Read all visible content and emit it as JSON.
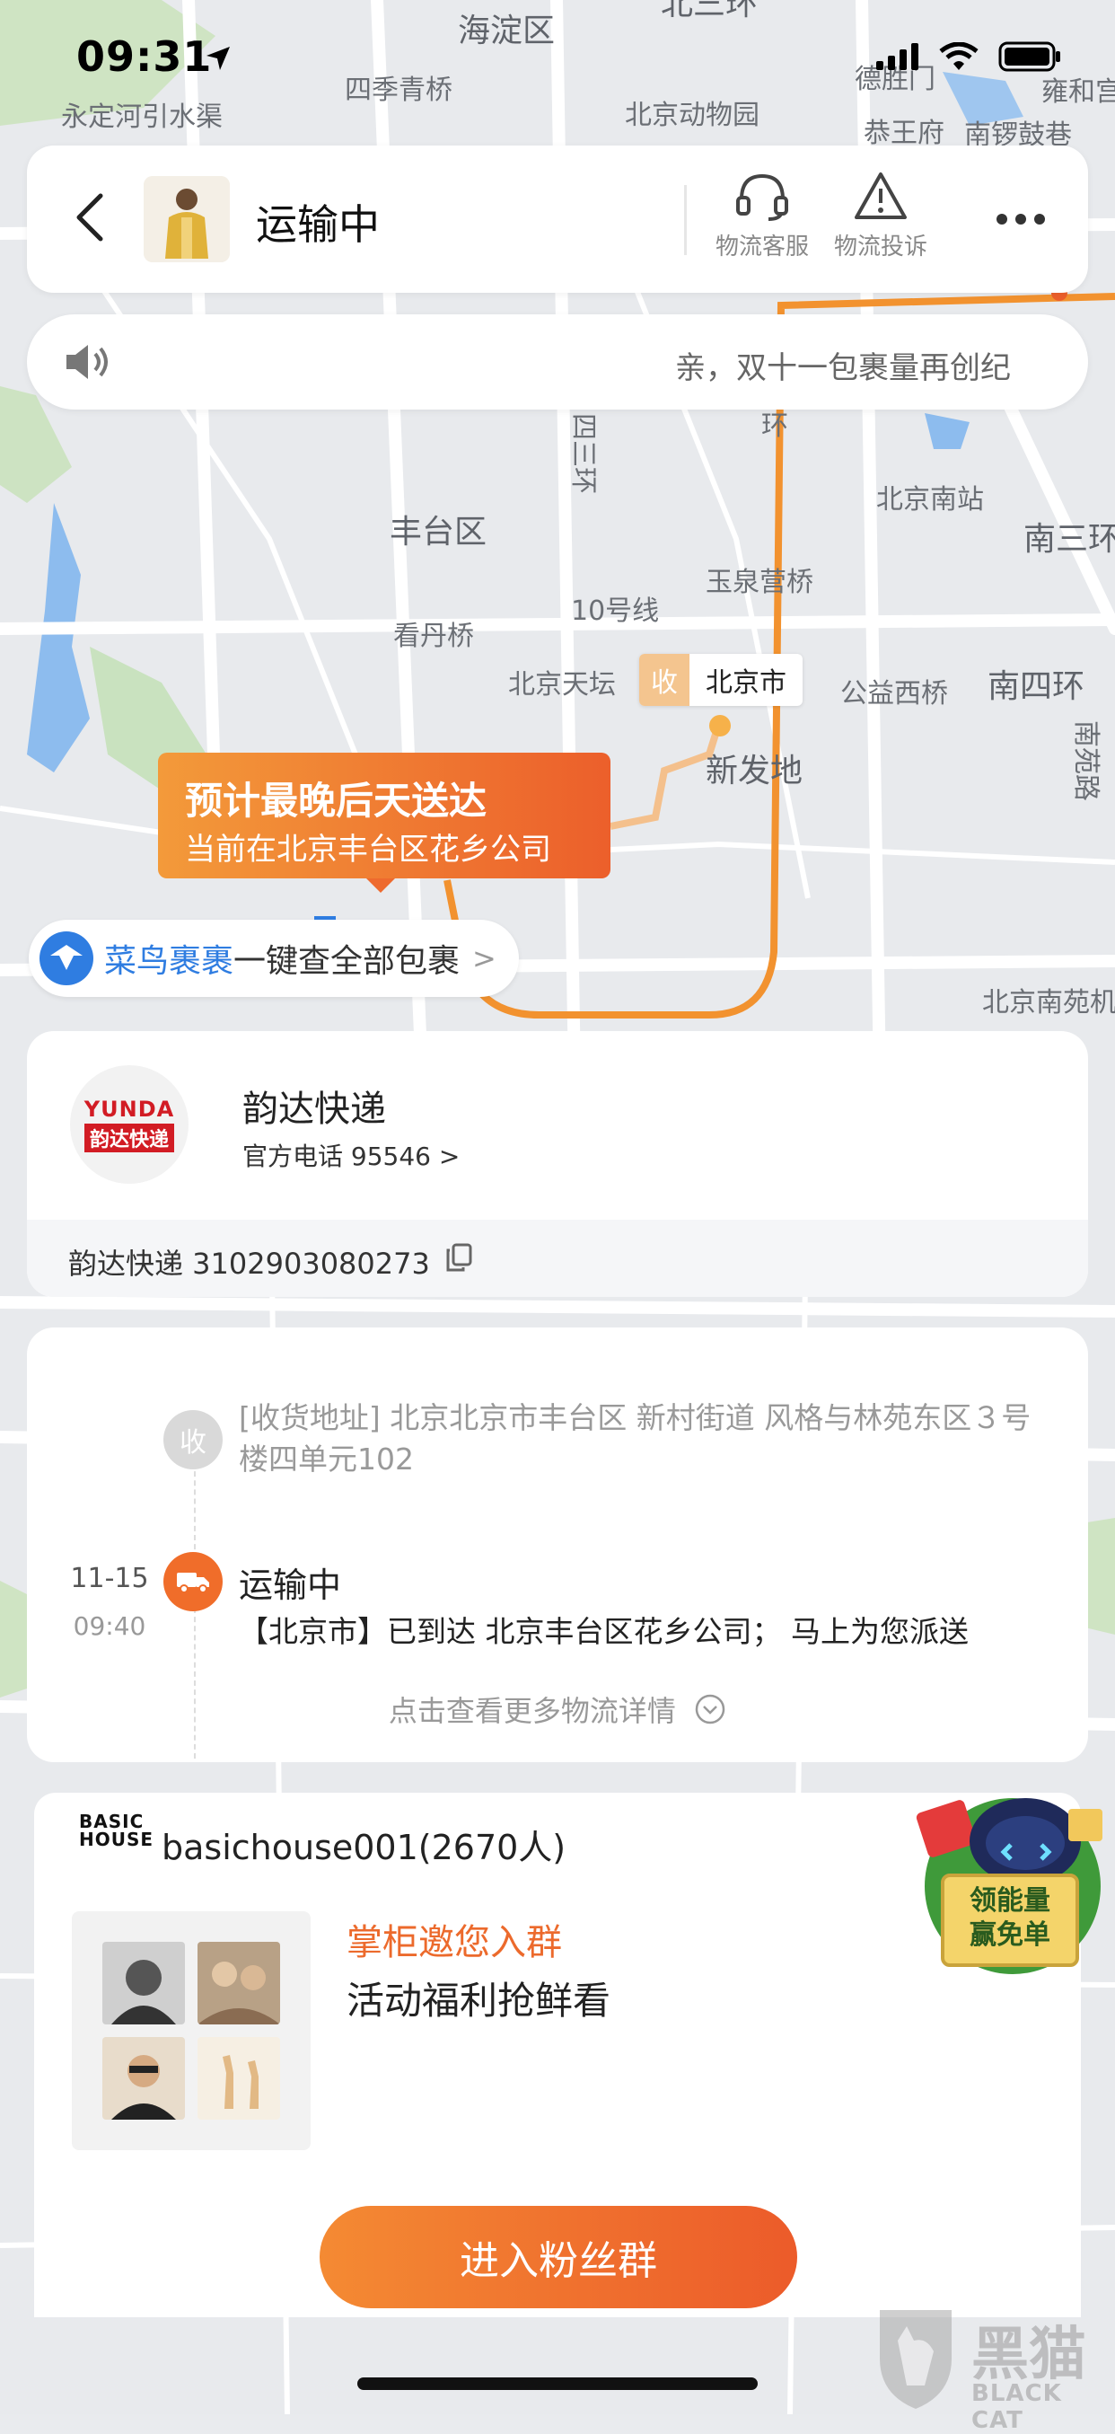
{
  "status_bar": {
    "time": "09:31"
  },
  "header": {
    "title": "运输中",
    "actions": [
      {
        "label": "物流客服",
        "icon": "headset-icon"
      },
      {
        "label": "物流投诉",
        "icon": "warning-icon"
      }
    ],
    "more_icon": "more-icon"
  },
  "notice": {
    "text": "亲，双十一包裹量再创纪"
  },
  "map": {
    "labels": [
      "海淀区",
      "四季青桥",
      "北京动物园",
      "德胜门",
      "雍和宫",
      "永定河引水渠",
      "恭王府",
      "南锣鼓巷",
      "北三环",
      "丰台区",
      "四三环",
      "北京南站",
      "南三环",
      "玉泉营桥",
      "10号线",
      "看丹桥",
      "北京天坛",
      "公益西桥",
      "南四环",
      "新发地",
      "南苑路",
      "北京南苑机",
      "环"
    ],
    "route_color": "#f2922f"
  },
  "eta": {
    "title": "预计最晚后天送达",
    "subtitle": "当前在北京丰台区花乡公司"
  },
  "destination": {
    "badge": "收",
    "label": "北京市"
  },
  "cainiao": {
    "brand": "菜鸟裹裹",
    "text": "一键查全部包裹",
    "arrow": ">"
  },
  "courier": {
    "logo_en": "YUNDA",
    "logo_cn": "韵达快递",
    "name": "韵达快递",
    "phone": "官方电话 95546 >",
    "tracking": "韵达快递 3102903080273"
  },
  "timeline": {
    "receiver_badge": "收",
    "receiver_address": "[收货地址] 北京北京市丰台区  新村街道   风格与林苑东区３号楼四单元102",
    "event": {
      "date": "11-15",
      "time": "09:40",
      "title": "运输中",
      "desc": "【北京市】已到达 北京丰台区花乡公司； 马上为您派送"
    },
    "more": "点击查看更多物流详情"
  },
  "group": {
    "shop_logo_line1": "BASIC",
    "shop_logo_line2": "HOUSE",
    "shop_name": "basichouse001(2670人)",
    "invite": "掌柜邀您入群",
    "benefit": "活动福利抢鲜看",
    "join_label": "进入粉丝群"
  },
  "promo": {
    "line1": "领能量",
    "line2": "赢免单"
  },
  "watermark": {
    "cn": "黑猫",
    "en": "BLACK CAT"
  },
  "colors": {
    "accent": "#ec5f2b",
    "accent_light": "#f39a3a",
    "cainiao_blue": "#2f7de1",
    "yunda_red": "#d21c24"
  }
}
